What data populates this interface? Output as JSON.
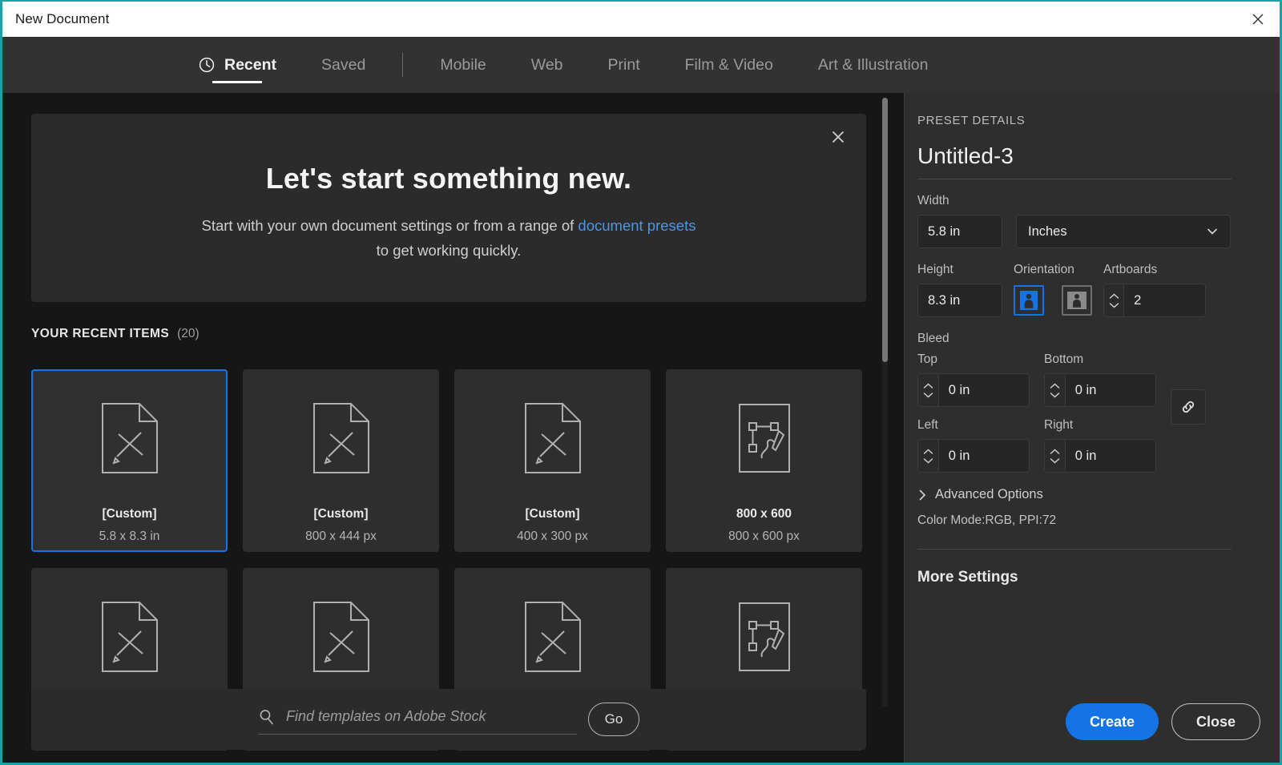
{
  "window": {
    "title": "New Document",
    "close_icon": "close-icon"
  },
  "tabs": [
    {
      "label": "Recent",
      "icon": "clock-icon",
      "active": true
    },
    {
      "label": "Saved",
      "icon": null,
      "active": false
    },
    {
      "label": "Mobile",
      "icon": null,
      "active": false
    },
    {
      "label": "Web",
      "icon": null,
      "active": false
    },
    {
      "label": "Print",
      "icon": null,
      "active": false
    },
    {
      "label": "Film & Video",
      "icon": null,
      "active": false
    },
    {
      "label": "Art & Illustration",
      "icon": null,
      "active": false
    }
  ],
  "banner": {
    "heading": "Let's start something new.",
    "line1_before": "Start with your own document settings or from a range of ",
    "link": "document presets",
    "line2": "to get working quickly.",
    "close_icon": "close-icon"
  },
  "recent": {
    "heading": "YOUR RECENT ITEMS",
    "count": "(20)",
    "items": [
      {
        "name": "[Custom]",
        "dimensions": "5.8 x 8.3 in",
        "thumb": "document-ruler-pencil-icon",
        "selected": true
      },
      {
        "name": "[Custom]",
        "dimensions": "800 x 444 px",
        "thumb": "document-ruler-pencil-icon",
        "selected": false
      },
      {
        "name": "[Custom]",
        "dimensions": "400 x 300 px",
        "thumb": "document-ruler-pencil-icon",
        "selected": false
      },
      {
        "name": "800 x 600",
        "dimensions": "800 x 600 px",
        "thumb": "artboard-pen-path-icon",
        "selected": false
      },
      {
        "name": "",
        "dimensions": "",
        "thumb": "document-ruler-pencil-icon",
        "selected": false
      },
      {
        "name": "",
        "dimensions": "",
        "thumb": "document-ruler-pencil-icon",
        "selected": false
      },
      {
        "name": "",
        "dimensions": "",
        "thumb": "document-ruler-pencil-icon",
        "selected": false
      },
      {
        "name": "",
        "dimensions": "",
        "thumb": "artboard-pen-path-icon",
        "selected": false
      }
    ]
  },
  "search": {
    "placeholder": "Find templates on Adobe Stock",
    "value": "",
    "go_label": "Go",
    "icon": "search-icon"
  },
  "preset": {
    "section_title": "PRESET DETAILS",
    "document_name": "Untitled-3",
    "width_label": "Width",
    "width_value": "5.8 in",
    "units_value": "Inches",
    "height_label": "Height",
    "height_value": "8.3 in",
    "orientation_label": "Orientation",
    "orientation_selected": "portrait",
    "artboards_label": "Artboards",
    "artboards_value": "2",
    "bleed_label": "Bleed",
    "bleed_top_label": "Top",
    "bleed_top_value": "0 in",
    "bleed_bottom_label": "Bottom",
    "bleed_bottom_value": "0 in",
    "bleed_left_label": "Left",
    "bleed_left_value": "0 in",
    "bleed_right_label": "Right",
    "bleed_right_value": "0 in",
    "link_icon": "link-chain-icon",
    "advanced_options_label": "Advanced Options",
    "color_mode_summary": "Color Mode:RGB, PPI:72",
    "more_settings_label": "More Settings"
  },
  "footer": {
    "create_label": "Create",
    "close_label": "Close"
  },
  "colors": {
    "accent_blue": "#1473e6",
    "link_blue": "#4a96e8",
    "window_border": "#16a3a8",
    "panel_bg": "#2e2e2e",
    "content_bg": "#161616",
    "tile_bg": "#2e2e2e",
    "tabbar_bg": "#323232"
  }
}
